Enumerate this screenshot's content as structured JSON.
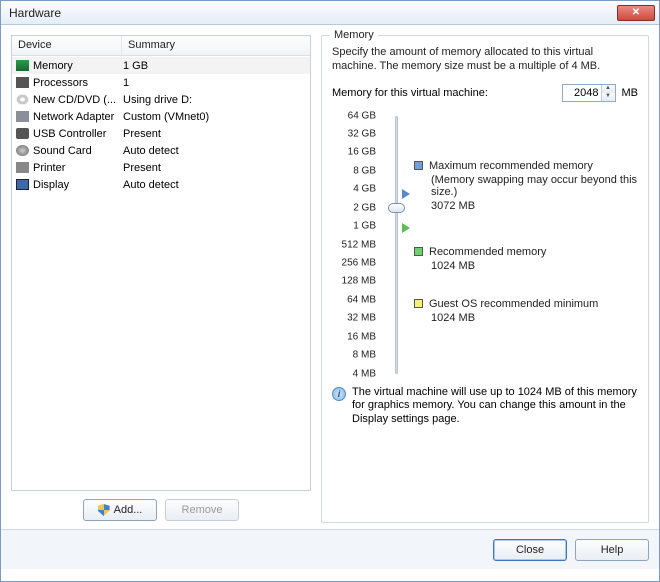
{
  "window": {
    "title": "Hardware"
  },
  "table": {
    "headers": {
      "device": "Device",
      "summary": "Summary"
    },
    "rows": [
      {
        "icon": "ic-mem",
        "device": "Memory",
        "summary": "1 GB",
        "selected": true
      },
      {
        "icon": "ic-cpu",
        "device": "Processors",
        "summary": "1"
      },
      {
        "icon": "ic-cd",
        "device": "New CD/DVD (...",
        "summary": "Using drive D:"
      },
      {
        "icon": "ic-net",
        "device": "Network Adapter",
        "summary": "Custom (VMnet0)"
      },
      {
        "icon": "ic-usb",
        "device": "USB Controller",
        "summary": "Present"
      },
      {
        "icon": "ic-snd",
        "device": "Sound Card",
        "summary": "Auto detect"
      },
      {
        "icon": "ic-prn",
        "device": "Printer",
        "summary": "Present"
      },
      {
        "icon": "ic-dsp",
        "device": "Display",
        "summary": "Auto detect"
      }
    ]
  },
  "buttons": {
    "add": "Add...",
    "remove": "Remove",
    "close": "Close",
    "help": "Help"
  },
  "memory": {
    "legend": "Memory",
    "intro": "Specify the amount of memory allocated to this virtual machine. The memory size must be a multiple of 4 MB.",
    "field_label": "Memory for this virtual machine:",
    "value": "2048",
    "unit": "MB",
    "ticks": [
      "64 GB",
      "32 GB",
      "16 GB",
      "8 GB",
      "4 GB",
      "2 GB",
      "1 GB",
      "512 MB",
      "256 MB",
      "128 MB",
      "64 MB",
      "32 MB",
      "16 MB",
      "8 MB",
      "4 MB"
    ],
    "max_label": "Maximum recommended memory",
    "max_note": "(Memory swapping may occur beyond this size.)",
    "max_value": "3072 MB",
    "rec_label": "Recommended memory",
    "rec_value": "1024 MB",
    "guest_label": "Guest OS recommended minimum",
    "guest_value": "1024 MB",
    "footer": "The virtual machine will use up to 1024 MB of this memory for graphics memory. You can change this amount in the Display settings page."
  }
}
